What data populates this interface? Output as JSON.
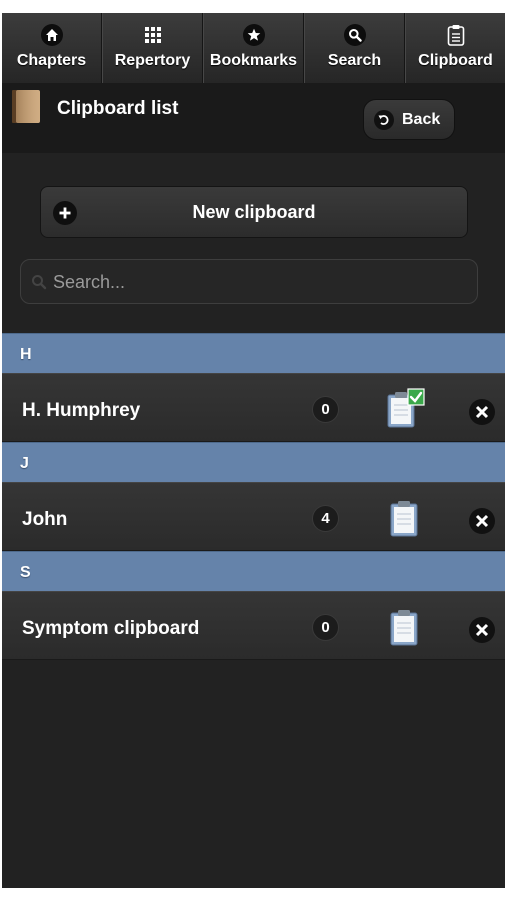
{
  "nav": {
    "tabs": [
      {
        "label": "Chapters",
        "icon": "home-icon"
      },
      {
        "label": "Repertory",
        "icon": "grid-icon"
      },
      {
        "label": "Bookmarks",
        "icon": "star-icon"
      },
      {
        "label": "Search",
        "icon": "search-icon"
      },
      {
        "label": "Clipboard",
        "icon": "clipboard-icon"
      }
    ]
  },
  "header": {
    "title": "Clipboard list",
    "back_label": "Back"
  },
  "new_clipboard": {
    "label": "New clipboard"
  },
  "search": {
    "placeholder": "Search...",
    "value": ""
  },
  "groups": [
    {
      "letter": "H",
      "items": [
        {
          "name": "H. Humphrey",
          "count": "0",
          "active": true
        }
      ]
    },
    {
      "letter": "J",
      "items": [
        {
          "name": "John",
          "count": "4",
          "active": false
        }
      ]
    },
    {
      "letter": "S",
      "items": [
        {
          "name": "Symptom clipboard",
          "count": "0",
          "active": false
        }
      ]
    }
  ],
  "colors": {
    "divider": "#6583aa",
    "background": "#222222",
    "active_check": "#3aa84a"
  }
}
